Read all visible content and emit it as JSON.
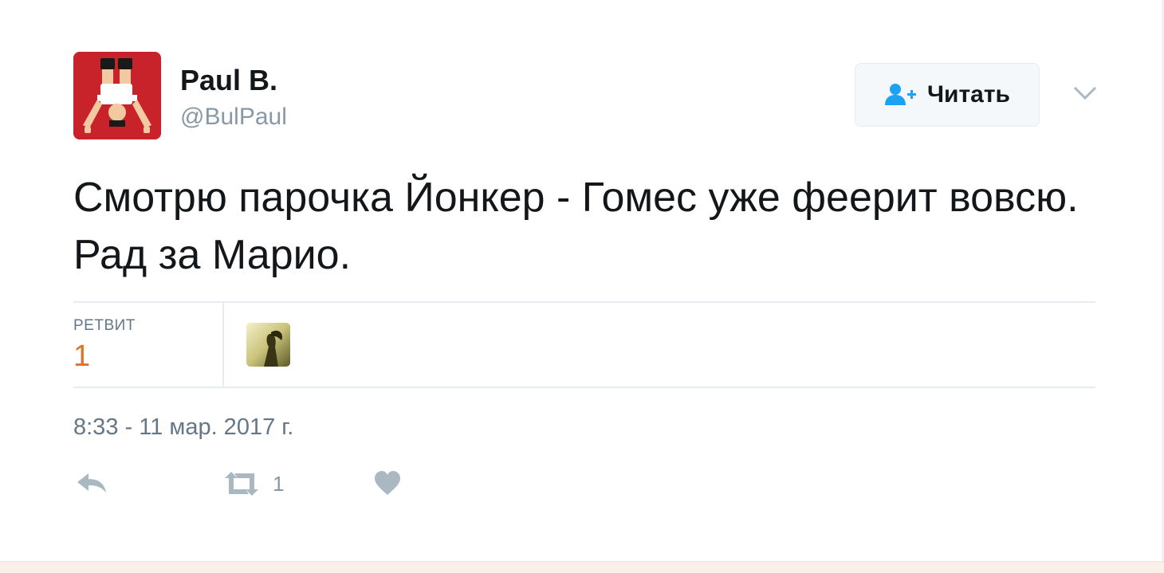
{
  "author": {
    "name": "Paul B.",
    "handle": "@BulPaul"
  },
  "follow_button": {
    "label": "Читать",
    "icon": "person-add-icon"
  },
  "tweet": {
    "text": "Смотрю парочка Йонкер - Гомес уже феерит вовсю. Рад за Марио."
  },
  "stats": {
    "retweets_label": "РЕТВИТ",
    "retweets_count": "1"
  },
  "timestamp": "8:33 - 11 мар. 2017 г.",
  "actions": {
    "reply_icon": "reply-icon",
    "retweet_icon": "retweet-icon",
    "retweet_count": "1",
    "like_icon": "heart-icon"
  },
  "colors": {
    "accent_blue": "#1da1f2",
    "retweet_count_orange": "#e0732a",
    "avatar_red": "#c8232b"
  }
}
